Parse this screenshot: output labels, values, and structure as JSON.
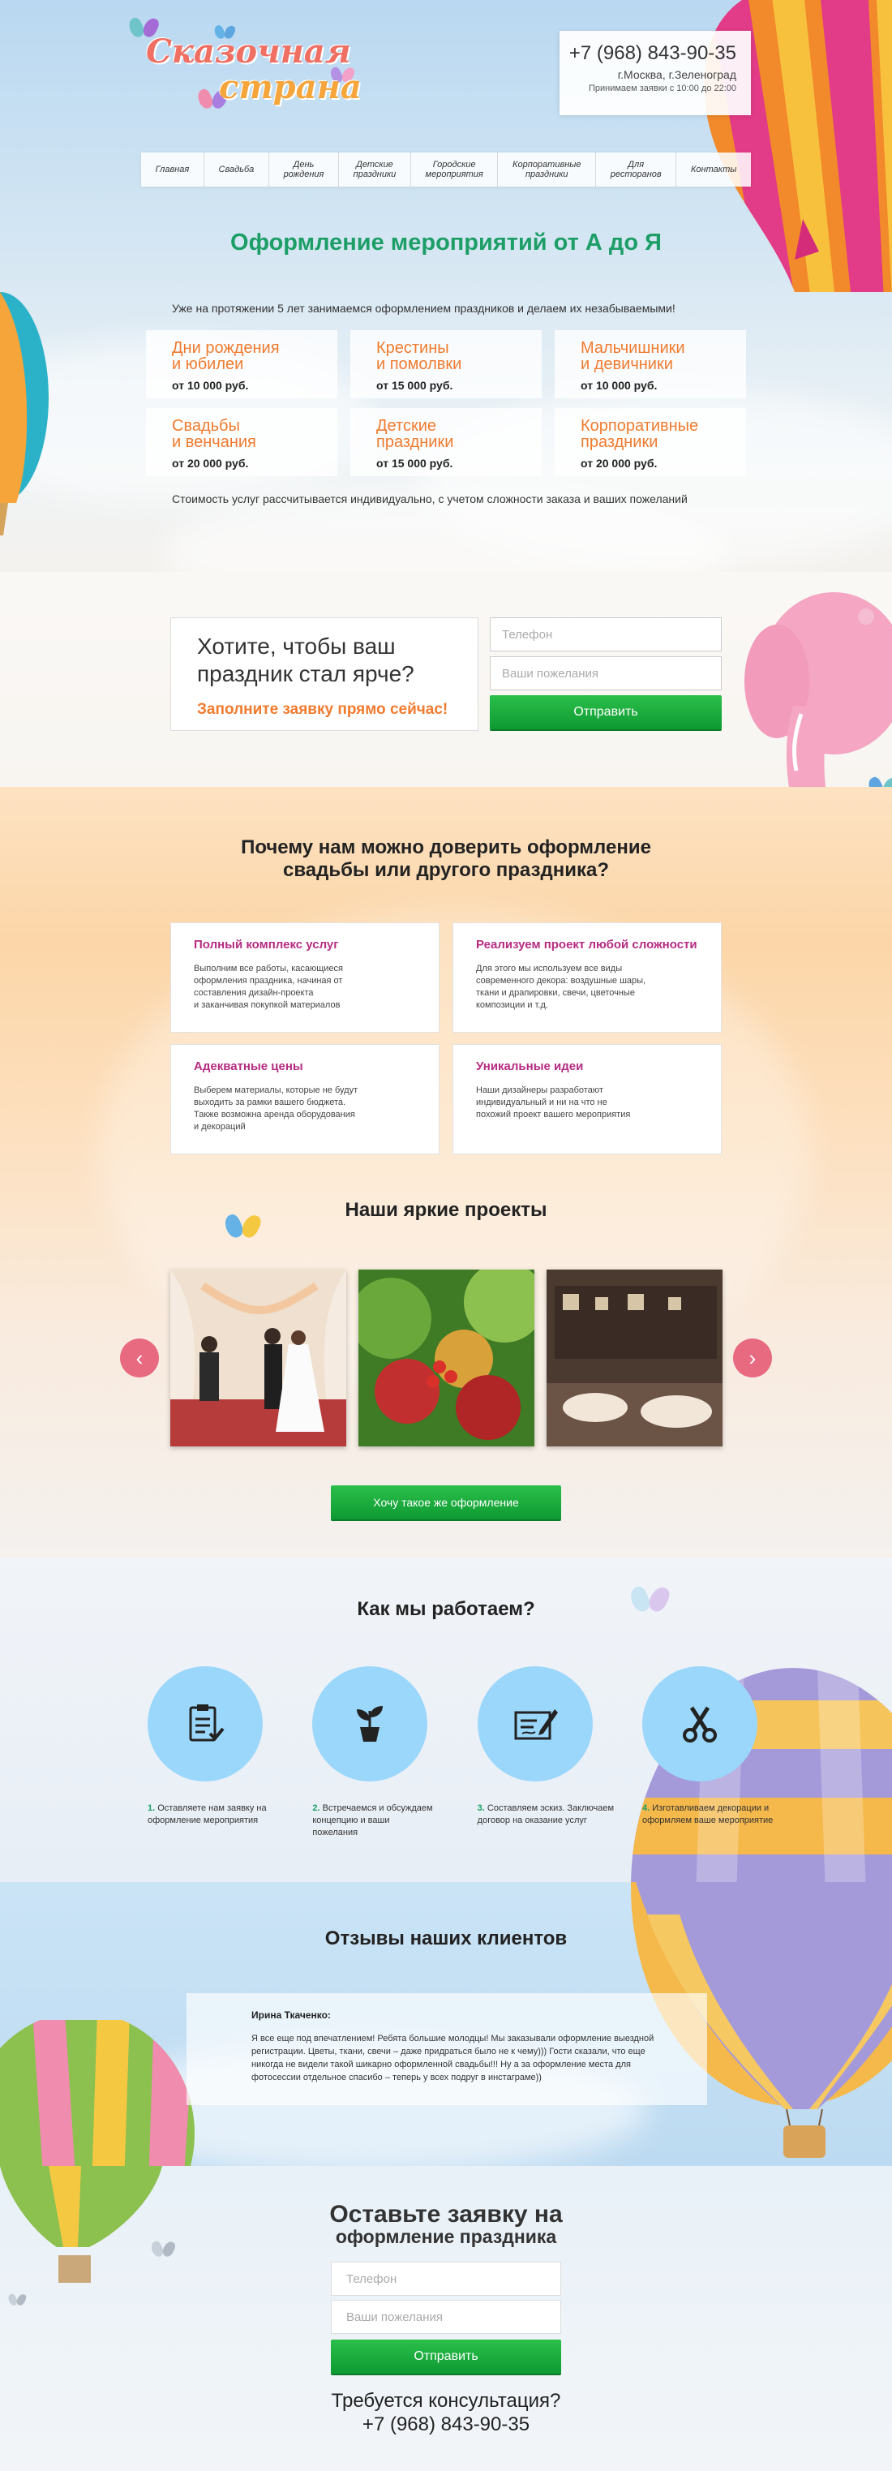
{
  "header": {
    "logo_line1": "Сказочная",
    "logo_line2": "страна",
    "phone": "+7 (968) 843-90-35",
    "city": "г.Москва, г.Зеленоград",
    "hours": "Принимаем заявки с 10:00 до 22:00"
  },
  "nav": {
    "items": [
      "Главная",
      "Свадьба",
      "День\nрождения",
      "Детские\nпраздники",
      "Городские\nмероприятия",
      "Корпоративные\nпраздники",
      "Для\nресторанов",
      "Контакты"
    ]
  },
  "hero": {
    "title": "Оформление мероприятий от А до Я",
    "intro": "Уже на протяжении 5 лет занимаемся оформлением  праздников и делаем их незабываемыми!",
    "prices": [
      {
        "title": "Дни рождения\nи юбилеи",
        "price": "от 10 000 руб."
      },
      {
        "title": "Крестины\nи помолвки",
        "price": "от 15 000 руб."
      },
      {
        "title": "Мальчишники\nи девичники",
        "price": "от 10 000 руб."
      },
      {
        "title": "Свадьбы\nи венчания",
        "price": "от 20 000 руб."
      },
      {
        "title": "Детские\nпраздники",
        "price": "от 15 000 руб."
      },
      {
        "title": "Корпоративные\nпраздники",
        "price": "от 20 000 руб."
      }
    ],
    "note": "Стоимость услуг рассчитывается индивидуально, с учетом сложности заказа и ваших пожеланий"
  },
  "form1": {
    "question": "Хотите, чтобы ваш\nпраздник стал ярче?",
    "subtitle": "Заполните заявку прямо сейчас!",
    "phone_placeholder": "Телефон",
    "wishes_placeholder": "Ваши пожелания",
    "submit": "Отправить"
  },
  "why": {
    "title": "Почему нам можно доверить оформление\nсвадьбы или другого праздника?",
    "features": [
      {
        "title": "Полный комплекс услуг",
        "text": "Выполним все работы, касающиеся\nоформления праздника, начиная от\nсоставления дизайн-проекта\nи заканчивая покупкой материалов"
      },
      {
        "title": "Реализуем проект любой сложности",
        "text": "Для этого мы используем все виды\nсовременного декора: воздушные шары,\nткани и драпировки, свечи, цветочные\nкомпозиции и т.д."
      },
      {
        "title": "Адекватные цены",
        "text": "Выберем материалы, которые не будут\nвыходить за рамки вашего бюджета.\nТакже возможна аренда оборудования\nи декораций"
      },
      {
        "title": "Уникальные идеи",
        "text": "Наши дизайнеры разработают\nиндивидуальный и ни на что не\nпохожий проект вашего мероприятия"
      }
    ]
  },
  "projects": {
    "title": "Наши яркие проекты",
    "cta": "Хочу такое же оформление",
    "prev": "‹",
    "next": "›"
  },
  "how": {
    "title": "Как мы работаем?",
    "steps": [
      {
        "num": "1.",
        "text": " Оставляете нам заявку на\nоформление мероприятия"
      },
      {
        "num": "2.",
        "text": " Встречаемся и обсуждаем\nконцепцию и ваши\nпожелания"
      },
      {
        "num": "3.",
        "text": " Составляем эскиз. Заключаем\nдоговор на оказание услуг"
      },
      {
        "num": "4.",
        "text": " Изготавливаем декорации и\nоформляем ваше мероприятие"
      }
    ]
  },
  "reviews": {
    "title": "Отзывы наших клиентов",
    "name": "Ирина Ткаченко:",
    "text": "Я все еще под впечатлением! Ребята большие молодцы! Мы заказывали оформление выездной регистрации. Цветы, ткани, свечи – даже придраться было не к чему))) Гости сказали, что еще никогда не видели такой шикарно оформленной свадьбы!!! Ну а за оформление места для фотосессии отдельное спасибо – теперь у всех подруг в инстаграме))"
  },
  "order": {
    "title1": "Оставьте заявку на",
    "title2": "оформление праздника",
    "phone_placeholder": "Телефон",
    "wishes_placeholder": "Ваши пожелания",
    "submit": "Отправить",
    "consult": "Требуется консультация?",
    "phone": "+7 (968) 843-90-35"
  },
  "colors": {
    "accent_green": "#1d9e67",
    "price_orange": "#f07b2f",
    "feature_purple": "#b52b82",
    "arrow_pink": "#e86a81",
    "step_circle": "#9bd7fb"
  }
}
